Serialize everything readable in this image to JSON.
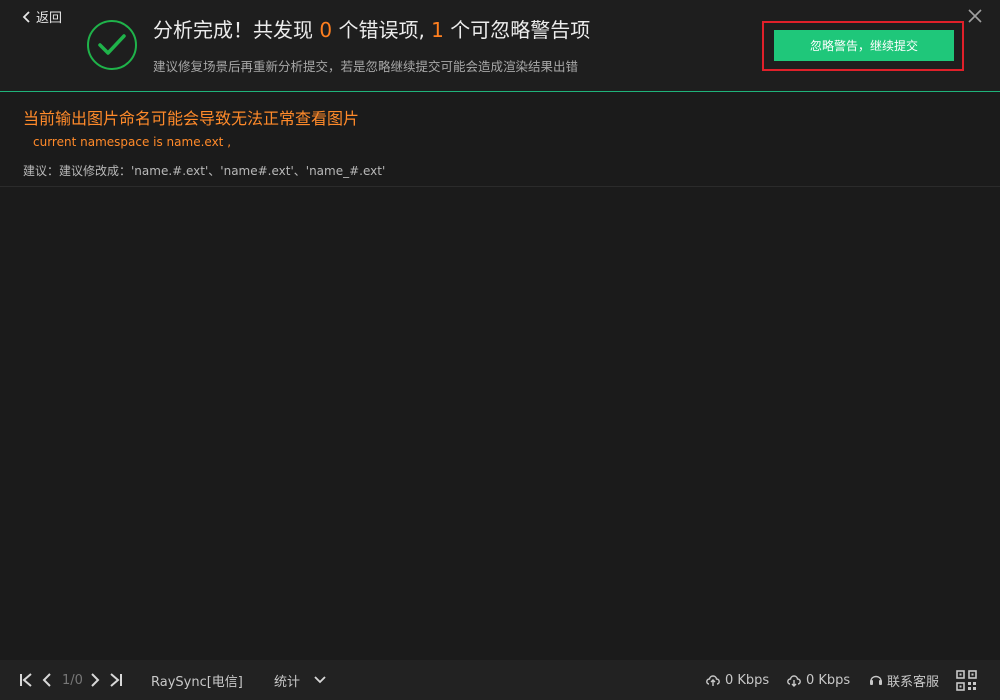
{
  "header": {
    "back_label": "返回",
    "title_prefix": "分析完成！共发现",
    "error_count": "0",
    "title_middle": "个错误项,",
    "warning_count": "1",
    "title_suffix": "个可忽略警告项",
    "subtitle": "建议修复场景后再重新分析提交，若是忽略继续提交可能会造成渲染结果出错",
    "ignore_button_label": "忽略警告，继续提交",
    "colors": {
      "accent": "#1fc77a",
      "warning": "#ff7f1f",
      "highlight": "#e0202a",
      "success": "#1fb34a"
    }
  },
  "warning": {
    "title": "当前输出图片命名可能会导致无法正常查看图片",
    "detail": "current namespace is name.ext ,",
    "suggestion": "建议：建议修改成：'name.#.ext'、'name#.ext'、'name_#.ext'"
  },
  "footer": {
    "page_indicator": "1/0",
    "server_label": "RaySync[电信]",
    "stats_label": "统计",
    "upload_speed": "0 Kbps",
    "download_speed": "0 Kbps",
    "support_label": "联系客服",
    "icons": [
      "first-page-icon",
      "prev-page-icon",
      "next-page-icon",
      "last-page-icon",
      "chevron-down-icon",
      "cloud-upload-icon",
      "cloud-download-icon",
      "headset-icon",
      "qr-code-icon"
    ]
  }
}
